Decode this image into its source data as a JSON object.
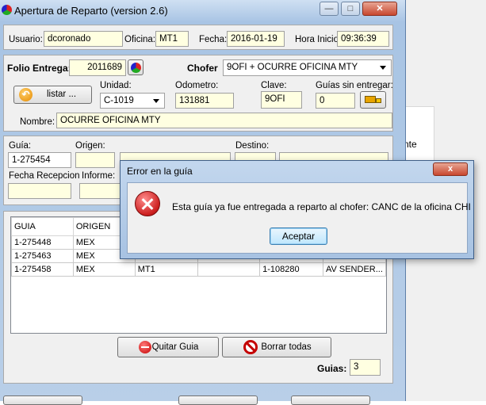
{
  "window": {
    "title": "Apertura  de Reparto (version 2.6)"
  },
  "background_window": {
    "text": "nte"
  },
  "header": {
    "usuario_label": "Usuario:",
    "usuario": "dcoronado",
    "oficina_label": "Oficina:",
    "oficina": "MT1",
    "fecha_label": "Fecha:",
    "fecha": "2016-01-19",
    "hora_label": "Hora Inicio:",
    "hora": "09:36:39"
  },
  "delivery": {
    "folio_label": "Folio Entrega:",
    "folio": "2011689",
    "chofer_label": "Chofer",
    "chofer": "9OFI + OCURRE OFICINA MTY",
    "listar_label": "listar ...",
    "unidad_label": "Unidad:",
    "unidad": "C-1019",
    "odometro_label": "Odometro:",
    "odometro": "131881",
    "clave_label": "Clave:",
    "clave": "9OFI",
    "guias_sin_label": "Guías sin entregar:",
    "guias_sin": "0",
    "nombre_label": "Nombre:",
    "nombre": "OCURRE OFICINA MTY"
  },
  "guia_form": {
    "guia_label": "Guía:",
    "guia": "1-275454",
    "origen_label": "Origen:",
    "destino_label": "Destino:",
    "fecha_recepcion_label": "Fecha Recepcion",
    "informe_label": "Informe:"
  },
  "grid": {
    "columns": [
      "GUIA",
      "ORIGEN",
      "",
      "",
      "",
      ""
    ],
    "rows": [
      [
        "1-275448",
        "MEX",
        "",
        "",
        "",
        ""
      ],
      [
        "1-275463",
        "MEX",
        "",
        "",
        "",
        ""
      ],
      [
        "1-275458",
        "MEX",
        "MT1",
        "",
        "1-108280",
        "AV SENDER..."
      ]
    ]
  },
  "actions": {
    "quitar_label": "Quitar Guia",
    "borrar_label": "Borrar todas",
    "guias_label": "Guias:",
    "guias": "3"
  },
  "dialog": {
    "title": "Error en la guía",
    "message": "Esta guía ya fue entregada a reparto al chofer: CANC de la oficina CHI",
    "ok_label": "Aceptar",
    "close_label": "x"
  },
  "colors": {
    "field_bg": "#ffffe1",
    "error_red": "#cc1f1f",
    "title_gradient": "#a8c4e4"
  }
}
